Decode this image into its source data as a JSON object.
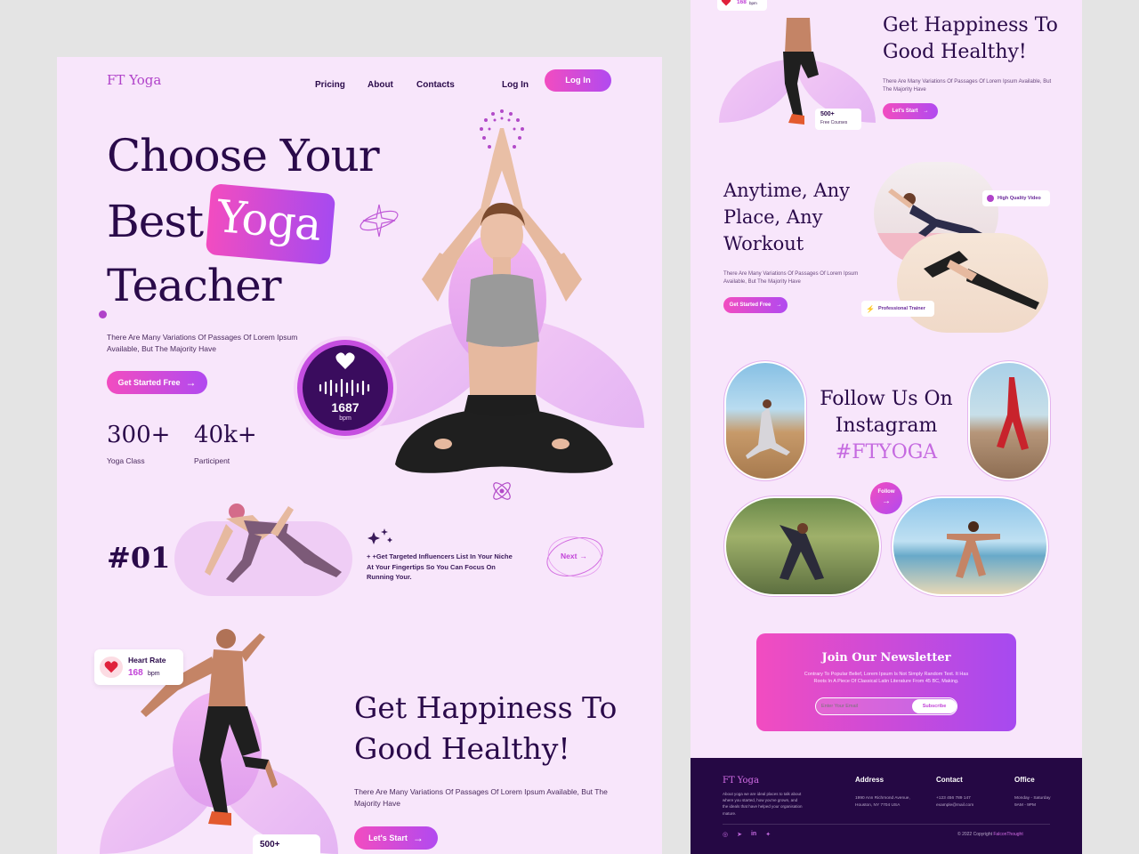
{
  "brand": "FT Yoga",
  "nav": {
    "items": [
      "Pricing",
      "About",
      "Contacts"
    ],
    "login_text": "Log In",
    "login_button": "Log In"
  },
  "hero": {
    "title_line1": "Choose Your",
    "title_best": "Best",
    "title_yoga": "Yoga",
    "title_line3": "Teacher",
    "desc": "There Are Many Variations Of Passages Of Lorem Ipsum Available, But The Majority Have",
    "cta": "Get Started Free",
    "stats": [
      {
        "value": "300+",
        "label": "Yoga Class"
      },
      {
        "value": "40k+",
        "label": "Participent"
      }
    ],
    "bpm_value": "1687",
    "bpm_unit": "bpm"
  },
  "step": {
    "number": "#01",
    "text": "+ +Get Targeted Influencers List In Your Niche At Your Fingertips So You Can Focus On Running Your.",
    "next": "Next"
  },
  "happiness": {
    "title_line1": "Get Happiness To",
    "title_line2": "Good Healthy!",
    "desc": "There Are Many Variations Of Passages Of Lorem Ipsum Available, But The Majority Have",
    "cta": "Let's Start",
    "heart_label": "Heart Rate",
    "heart_value": "168",
    "heart_unit": "bpm",
    "courses_value": "500+",
    "courses_label": "Free Courses"
  },
  "right": {
    "top_heart_value": "168",
    "top_heart_unit": "bpm",
    "happiness_title_line1": "Get Happiness To",
    "happiness_title_line2": "Good Healthy!",
    "happiness_desc": "There Are Many Variations Of Passages Of Lorem Ipsum Available, But The Majority Have",
    "happiness_cta": "Let's Start",
    "courses_value": "500+",
    "courses_label": "Free Courses",
    "anytime_line1": "Anytime, Any",
    "anytime_line2": "Place, Any",
    "anytime_line3": "Workout",
    "anytime_desc": "There Are Many Variations Of Passages Of Lorem Ipsum Available, But The Majority Have",
    "anytime_cta": "Get Started Free",
    "badge_video": "High Quality Video",
    "badge_trainer": "Professional Trainer",
    "instagram_line1": "Follow Us On",
    "instagram_line2": "Instagram",
    "instagram_tag": "#FTYOGA",
    "follow": "Follow",
    "newsletter_title": "Join Our Newsletter",
    "newsletter_desc": "Contrary To Popular Belief, Lorem Ipsum Is Not Simply Random Text. It Has Roots In A Piece Of Classical Latin Literature From 45 BC, Making.",
    "newsletter_placeholder": "Enter Your Email",
    "newsletter_button": "Subscribe"
  },
  "footer": {
    "brand": "FT Yoga",
    "about": "About yoga we are ideal places to talk about where you started, how you've grown, and the ideals that have helped your organisation mature.",
    "address_title": "Address",
    "address_text": "1990 Ann Richmond Avenue, Houston, NY 7704 USA",
    "contact_title": "Contact",
    "contact_phone": "+123 456 789 147",
    "contact_email": "example@mail.com",
    "office_title": "Office",
    "office_days": "Monday - Saturday",
    "office_hours": "9AM - 9PM",
    "copyright": "© 2022 Copyright ",
    "copyright_name": "FalconThought"
  },
  "colors": {
    "accent_pink": "#f24cc0",
    "accent_purple": "#a64af0",
    "dark": "#2a0a4a",
    "panel_bg": "#f8e6fb",
    "footer_bg": "#250844"
  }
}
